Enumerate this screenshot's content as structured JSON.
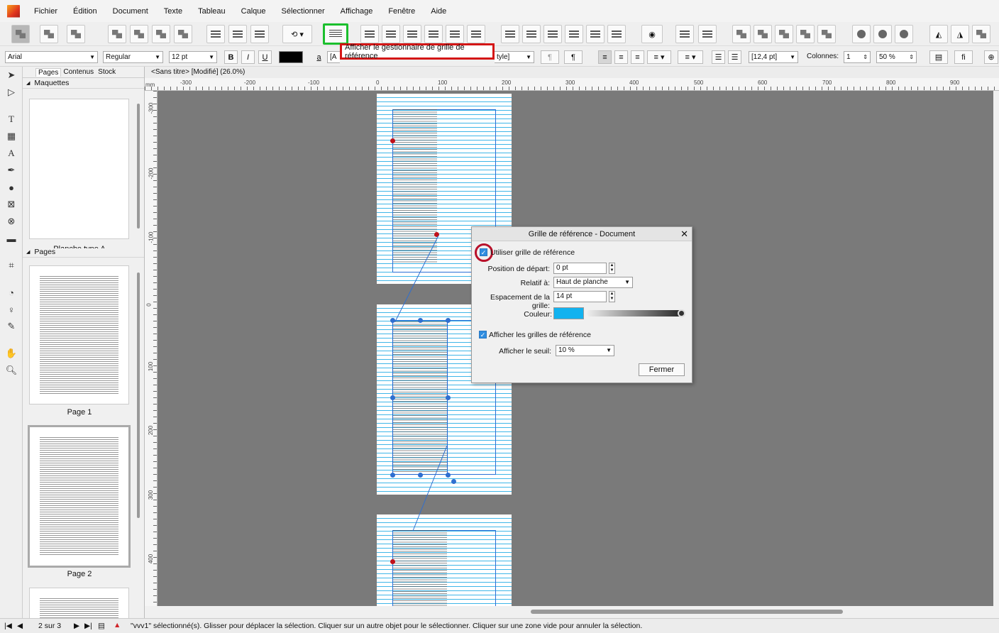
{
  "menu": [
    "Fichier",
    "Édition",
    "Document",
    "Texte",
    "Tableau",
    "Calque",
    "Sélectionner",
    "Affichage",
    "Fenêtre",
    "Aide"
  ],
  "tooltip": "Afficher le gestionnaire de grille de référence",
  "ctx": {
    "font": "Arial",
    "style": "Regular",
    "size": "12 pt",
    "bold": "B",
    "italic": "I",
    "underline": "U",
    "a_label": "a",
    "style_partial": "tyle]",
    "pilcrow1": "¶",
    "pilcrow2": "¶",
    "leading": "[12,4 pt]",
    "columns_label": "Colonnes:",
    "columns_value": "1",
    "gutter": "50 %",
    "fi": "fi",
    "bracket_partial": "[A"
  },
  "panel": {
    "tabs": [
      "Pages",
      "Contenus",
      "Stock"
    ],
    "masters_header": "Maquettes",
    "master_label": "Planche type A",
    "pages_header": "Pages",
    "page1_label": "Page 1",
    "page2_label": "Page 2"
  },
  "doc_tab": "<Sans titre> [Modifié] (26.0%)",
  "ruler": {
    "unit": "mm",
    "h_labels": [
      "-300",
      "-200",
      "-100",
      "0",
      "100",
      "200",
      "300",
      "400",
      "500",
      "600",
      "700",
      "800",
      "900"
    ],
    "v_labels": [
      "-300",
      "-200",
      "-100",
      "0",
      "100",
      "200",
      "300",
      "400"
    ]
  },
  "dialog": {
    "title": "Grille de référence - Document",
    "use_grid_label": "Utiliser grille de référence",
    "start_label": "Position de départ:",
    "start_value": "0 pt",
    "relative_label": "Relatif à:",
    "relative_value": "Haut de planche",
    "spacing_label": "Espacement de la grille:",
    "spacing_value": "14 pt",
    "color_label": "Couleur:",
    "color_value": "#12b2ef",
    "show_grids_label": "Afficher les grilles de référence",
    "threshold_label": "Afficher le seuil:",
    "threshold_value": "10 %",
    "close_button": "Fermer"
  },
  "status": {
    "page_indicator": "2 sur 3",
    "message": "\"vvv1\" sélectionné(s). Glisser pour déplacer la sélection. Cliquer sur un autre objet pour le sélectionner. Cliquer sur une zone vide pour annuler la sélection."
  },
  "colors": {
    "highlight_green": "#1bbf2d",
    "highlight_red": "#d41616",
    "baseline_grid": "#3fb6e8",
    "accent_blue": "#2f8de0"
  }
}
